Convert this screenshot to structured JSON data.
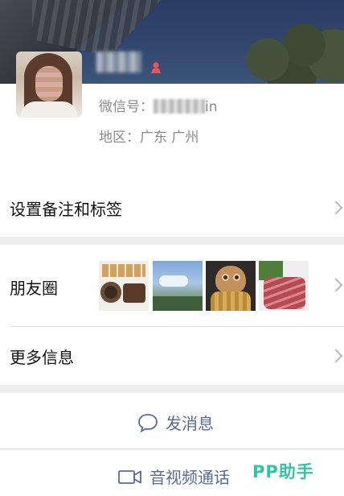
{
  "profile": {
    "wechat_id_label": "微信号：",
    "wechat_id_suffix": "in",
    "region_label": "地区：",
    "region_value": "广东 广州",
    "gender_icon": "female-icon"
  },
  "rows": {
    "remark": "设置备注和标签",
    "moments": "朋友圈",
    "more_info": "更多信息"
  },
  "moments_thumbnails": [
    "food-plate-photo",
    "sky-trees-photo",
    "cat-sweater-photo",
    "raw-meat-photo"
  ],
  "actions": {
    "send_message": "发消息",
    "video_call": "音视频通话"
  },
  "watermark": "PP助手",
  "colors": {
    "link_blue": "#576b95",
    "background": "#ededed",
    "watermark_green": "#35c3a6"
  }
}
